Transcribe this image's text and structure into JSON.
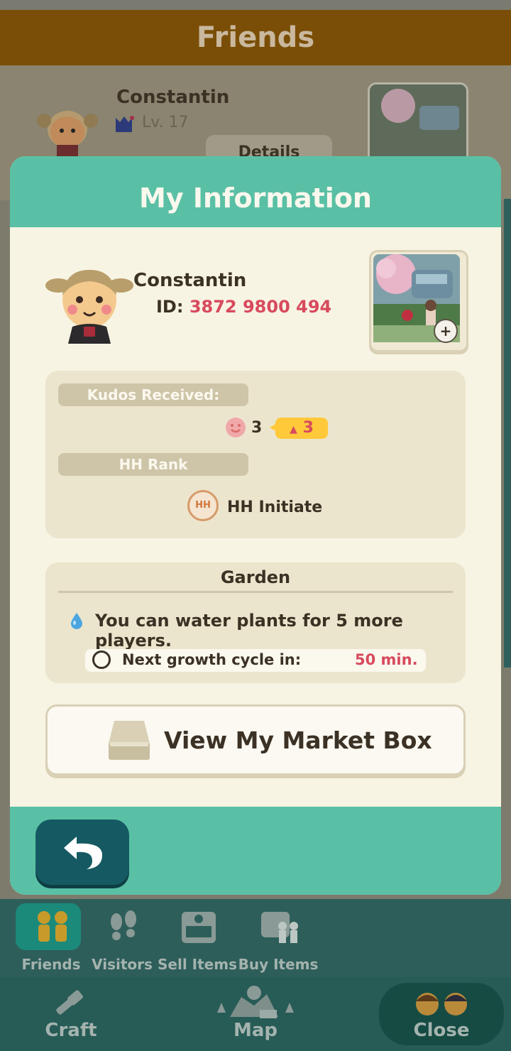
{
  "background": {
    "header_title": "Friends",
    "friend_name": "Constantin",
    "friend_level": "Lv. 17",
    "details_label": "Details"
  },
  "modal": {
    "title": "My Information",
    "profile": {
      "name": "Constantin",
      "id_label": "ID:",
      "id_value": "3872 9800 494"
    },
    "kudos": {
      "label": "Kudos Received:",
      "count": "3",
      "badge": "3"
    },
    "rank": {
      "label": "HH Rank",
      "name": "HH Initiate",
      "icon_text": "HH"
    },
    "garden": {
      "title": "Garden",
      "water_text": "You can water plants for 5 more players.",
      "growth_label": "Next growth cycle in:",
      "growth_value": "50 min."
    },
    "market_button": "View My Market Box"
  },
  "tabs": [
    {
      "label": "Friends",
      "icon": "friends-icon",
      "selected": true
    },
    {
      "label": "Visitors",
      "icon": "footprints-icon"
    },
    {
      "label": "Sell Items",
      "icon": "market-box-icon"
    },
    {
      "label": "Buy Items",
      "icon": "buy-items-icon"
    }
  ],
  "nav": {
    "craft": "Craft",
    "map": "Map",
    "close": "Close"
  },
  "colors": {
    "teal": "#5ac0a5",
    "cream": "#f8f4e3",
    "accent_red": "#d84a5d",
    "dark_teal": "#155a62"
  }
}
